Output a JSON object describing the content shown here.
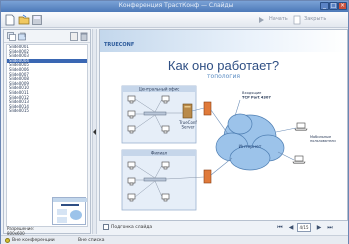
{
  "window": {
    "title": "Конференция ТрастКонф — Слайды",
    "minimize_glyph": "_",
    "maximize_glyph": "□",
    "close_glyph": "×"
  },
  "toolbar": {
    "begin_label": "Начать",
    "close_label": "Закрыть",
    "icons": [
      "new-document-icon",
      "open-folder-icon",
      "save-icon"
    ]
  },
  "sidebar": {
    "slides": [
      "Slide0001",
      "Slide0002",
      "Slide0003",
      "Slide0004",
      "Slide0005",
      "Slide0006",
      "Slide0007",
      "Slide0008",
      "Slide0009",
      "Slide0010",
      "Slide0011",
      "Slide0012",
      "Slide0013",
      "Slide0014",
      "Slide0015"
    ],
    "selected_index": 3,
    "resolution_label": "Разрешение:",
    "resolution_value": "800x600"
  },
  "slide": {
    "logo_text": "TRUECONF",
    "title": "Как оно работает?",
    "subtitle": "топология",
    "central_office_label": "Центральный офис",
    "branch_label": "Филиал",
    "server_label_1": "TrueConf",
    "server_label_2": "Server",
    "access_label_1": "Входящие",
    "access_label_2": "TCP Port 4307",
    "internet_label": "Интернет",
    "mobile_label_1": "Мобильные",
    "mobile_label_2": "пользователи"
  },
  "bottom": {
    "checkbox_label": "Подгонка слайда",
    "page_value": "4/15"
  },
  "status": {
    "conference_label": "Вне конференции",
    "list_label": "Вне списка"
  },
  "colors": {
    "accent": "#3a67b3",
    "title_blue": "#2f4f84",
    "cloud_blue": "#9cc3ea"
  }
}
